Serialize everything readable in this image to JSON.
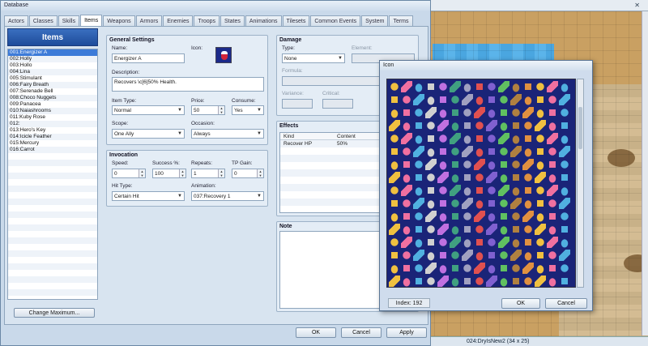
{
  "database": {
    "title": "Database",
    "tabs": [
      "Actors",
      "Classes",
      "Skills",
      "Items",
      "Weapons",
      "Armors",
      "Enemies",
      "Troops",
      "States",
      "Animations",
      "Tilesets",
      "Common Events",
      "System",
      "Terms"
    ],
    "active_tab": "Items"
  },
  "items_panel": {
    "header": "Items",
    "items": [
      "001:Energizer A",
      "002:Holly",
      "003:Hollo",
      "004:Lina",
      "005:Stimulant",
      "006:Fairy Breath",
      "007:Serenade Bell",
      "008:Choco Nuggets",
      "009:Panacea",
      "010:Naiashrooms",
      "011:Kuby Rose",
      "012:",
      "013:Hero's Key",
      "014:Icicle Feather",
      "015:Mercury",
      "016:Carrot"
    ],
    "selected_index": 0,
    "change_max_label": "Change Maximum..."
  },
  "general_settings": {
    "title": "General Settings",
    "name_label": "Name:",
    "name_value": "Energizer A",
    "icon_label": "Icon:",
    "description_label": "Description:",
    "description_value": "Recovers \\c[6]50% Health.",
    "item_type_label": "Item Type:",
    "item_type_value": "Normal",
    "price_label": "Price:",
    "price_value": "50",
    "consume_label": "Consume:",
    "consume_value": "Yes",
    "scope_label": "Scope:",
    "scope_value": "One Ally",
    "occasion_label": "Occasion:",
    "occasion_value": "Always"
  },
  "invocation": {
    "title": "Invocation",
    "speed_label": "Speed:",
    "speed_value": "0",
    "success_label": "Success %:",
    "success_value": "100",
    "repeats_label": "Repeats:",
    "repeats_value": "1",
    "tp_gain_label": "TP Gain:",
    "tp_gain_value": "0",
    "hit_type_label": "Hit Type:",
    "hit_type_value": "Certain Hit",
    "animation_label": "Animation:",
    "animation_value": "037:Recovery 1"
  },
  "damage": {
    "title": "Damage",
    "type_label": "Type:",
    "type_value": "None",
    "element_label": "Element:",
    "formula_label": "Formula:",
    "variance_label": "Variance:",
    "critical_label": "Critical:"
  },
  "effects": {
    "title": "Effects",
    "col_kind": "Kind",
    "col_content": "Content",
    "rows": [
      {
        "kind": "Recover HP",
        "content": "50%"
      }
    ]
  },
  "note": {
    "title": "Note"
  },
  "buttons": {
    "ok": "OK",
    "cancel": "Cancel",
    "apply": "Apply"
  },
  "icon_dialog": {
    "title": "Icon",
    "index_text": "Index: 192",
    "ok": "OK",
    "cancel": "Cancel",
    "palette": [
      "#f0c040",
      "#e05050",
      "#50b0e0",
      "#60c060",
      "#c070e0",
      "#e09040",
      "#a0a0c0",
      "#f070a0",
      "#8060d0",
      "#d0d0d0",
      "#b08040",
      "#40a080"
    ]
  },
  "map": {
    "status_text": "024:DryIsNew2 (34 x 25)"
  }
}
